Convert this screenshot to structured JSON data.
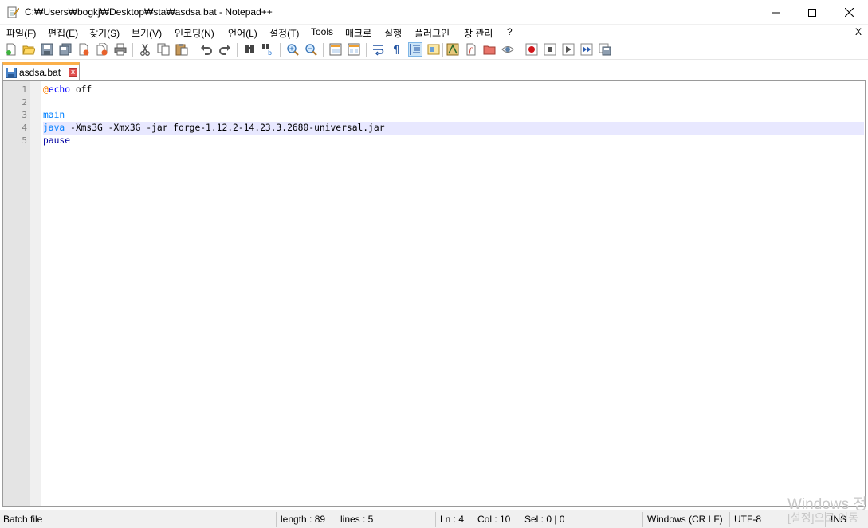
{
  "window": {
    "title": "C:₩Users₩bogkj₩Desktop₩sta₩asdsa.bat - Notepad++"
  },
  "menu": {
    "items": [
      "파일(F)",
      "편집(E)",
      "찾기(S)",
      "보기(V)",
      "인코딩(N)",
      "언어(L)",
      "설정(T)",
      "Tools",
      "매크로",
      "실행",
      "플러그인",
      "창 관리",
      "?"
    ],
    "close_label": "X"
  },
  "toolbar": {
    "buttons": [
      "new-file",
      "open-file",
      "save",
      "save-all",
      "close",
      "close-all",
      "print",
      "cut",
      "copy",
      "paste",
      "undo",
      "redo",
      "find",
      "replace",
      "zoom-in",
      "zoom-out",
      "sync-vertical",
      "sync-horizontal",
      "word-wrap",
      "show-all-chars",
      "indent-guide",
      "document-map",
      "function-list",
      "folder-workspace",
      "monitor",
      "record-macro",
      "stop-macro",
      "play-macro",
      "run-macro-multiple",
      "save-macro"
    ],
    "active_button": "indent-guide"
  },
  "tabs": [
    {
      "label": "asdsa.bat",
      "close_glyph": "x"
    }
  ],
  "editor": {
    "line_numbers": [
      "1",
      "2",
      "3",
      "4",
      "5"
    ],
    "lines": {
      "l1_at": "@",
      "l1_kw": "echo",
      "l1_rest": " off",
      "l3_cmd": "main",
      "l4_cmd": "java",
      "l4_rest": " -Xms3G -Xmx3G -jar forge-1.12.2-14.23.3.2680-universal.jar",
      "l5_kw": "pause"
    },
    "current_line": 4
  },
  "watermark": {
    "line1": "Windows 정",
    "line2": "[설정]으로 이동"
  },
  "status": {
    "language": "Batch file",
    "length": "length : 89",
    "lines": "lines : 5",
    "ln": "Ln : 4",
    "col": "Col : 10",
    "sel": "Sel : 0 | 0",
    "eol": "Windows (CR LF)",
    "encoding": "UTF-8",
    "mode": "INS"
  },
  "colors": {
    "keyword": "#0000ff",
    "command": "#0080ff",
    "at_sign": "#ff8000",
    "current_line_bg": "#e8e8ff",
    "tab_accent": "#fbb04a"
  }
}
